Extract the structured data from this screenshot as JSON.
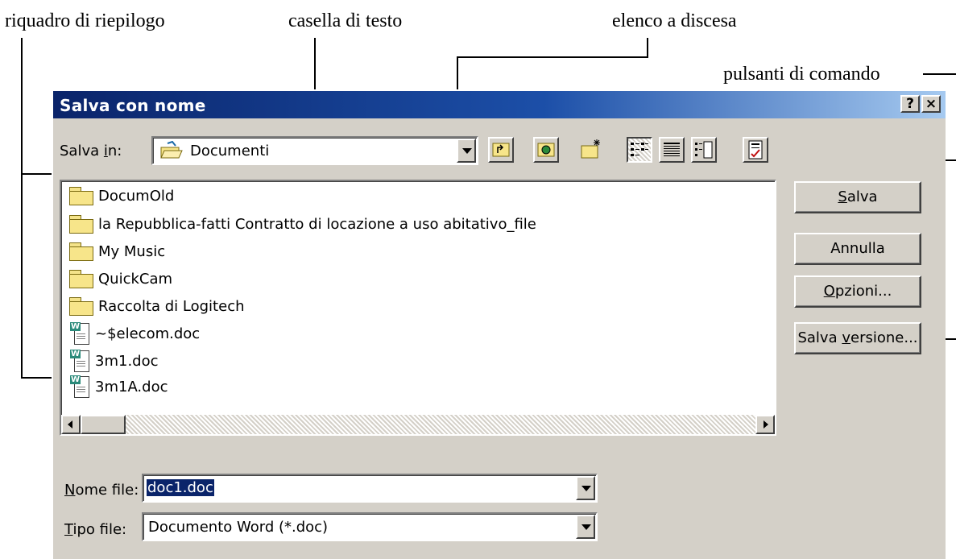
{
  "annotations": {
    "summary_pane": "riquadro di riepilogo",
    "text_box": "casella di testo",
    "dropdown_list": "elenco a discesa",
    "command_buttons": "pulsanti di comando"
  },
  "dialog": {
    "title": "Salva con nome",
    "help_glyph": "?",
    "close_glyph": "×"
  },
  "save_in": {
    "label_prefix": "Salva ",
    "label_key": "i",
    "label_suffix": "n:",
    "value": "Documenti"
  },
  "toolbar": {
    "tools": [
      "up-one-level-icon",
      "search-web-icon",
      "new-folder-icon",
      "list-view-icon",
      "details-view-icon",
      "properties-view-icon",
      "tools-icon"
    ]
  },
  "files": [
    {
      "name": "DocumOld",
      "type": "folder"
    },
    {
      "name": "la Repubblica-fatti Contratto di locazione a uso abitativo_file",
      "type": "folder"
    },
    {
      "name": "My Music",
      "type": "folder"
    },
    {
      "name": "QuickCam",
      "type": "folder"
    },
    {
      "name": "Raccolta di Logitech",
      "type": "folder"
    },
    {
      "name": "~$elecom.doc",
      "type": "document"
    },
    {
      "name": "3m1.doc",
      "type": "document"
    },
    {
      "name": "3m1A.doc",
      "type": "document"
    }
  ],
  "buttons": {
    "save_key": "S",
    "save_rest": "alva",
    "cancel": "Annulla",
    "options_key": "O",
    "options_rest": "pzioni...",
    "save_version_pre": "Salva ",
    "save_version_key": "v",
    "save_version_rest": "ersione..."
  },
  "filename": {
    "label_key": "N",
    "label_rest": "ome file:",
    "value": "doc1.doc"
  },
  "filetype": {
    "label_key": "T",
    "label_rest": "ipo file:",
    "value": "Documento Word (*.doc)"
  },
  "colors": {
    "title_gradient_start": "#0a246a",
    "title_gradient_end": "#a6caf0",
    "dialog_face": "#d4d0c8",
    "selection": "#0a246a"
  }
}
